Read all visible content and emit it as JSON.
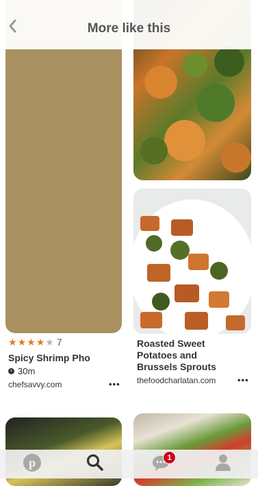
{
  "header": {
    "title": "More like this"
  },
  "pins": [
    {
      "rating": {
        "stars": 4,
        "max": 5,
        "count": "7"
      },
      "title": "Spicy Shrimp Pho",
      "time": "30m",
      "source": "chefsavvy.com",
      "more": "•••"
    },
    {
      "title": "Roasted Sweet Potatoes and Brussels Sprouts",
      "source": "thefoodcharlatan.com",
      "more": "•••"
    }
  ],
  "nav": {
    "messages_badge": "1"
  },
  "colors": {
    "star_filled": "#e47a1a",
    "star_empty": "#b5b5b5",
    "badge": "#d0021b",
    "header_text": "#555555"
  },
  "icons": [
    "chevron-left-icon",
    "star-icon",
    "clock-icon",
    "pinterest-logo-icon",
    "search-icon",
    "chat-icon",
    "person-icon",
    "more-icon"
  ]
}
